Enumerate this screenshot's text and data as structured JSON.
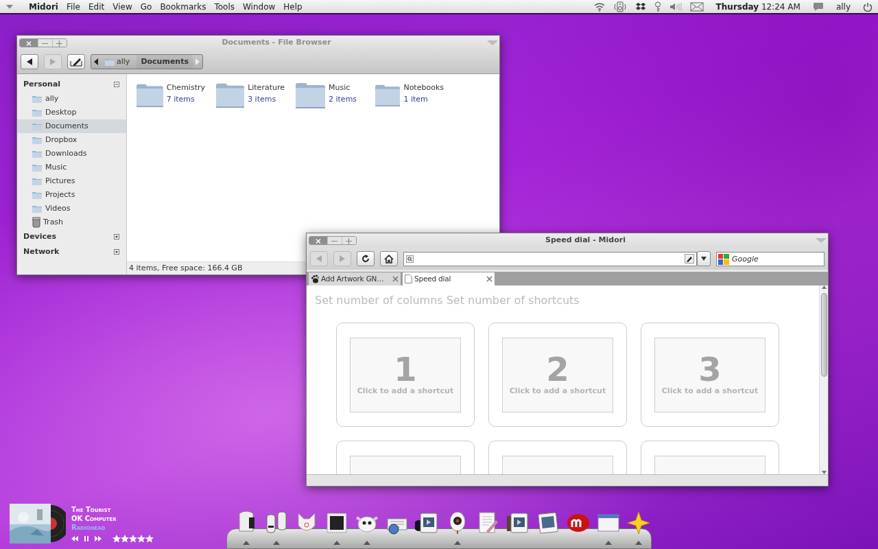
{
  "menubar": {
    "app": "Midori",
    "menus": [
      "File",
      "Edit",
      "View",
      "Go",
      "Bookmarks",
      "Tools",
      "Window",
      "Help"
    ],
    "clock": "**Thursday** 12:24 AM",
    "user": "ally"
  },
  "file_browser": {
    "title": "Documents - File Browser",
    "active": false,
    "path": [
      {
        "label": "ally",
        "selected": false
      },
      {
        "label": "Documents",
        "selected": true
      }
    ],
    "sidebar": [
      {
        "label": "Personal",
        "expanded": true,
        "items": [
          {
            "label": "ally",
            "kind": "home",
            "selected": false
          },
          {
            "label": "Desktop",
            "kind": "folder",
            "selected": false
          },
          {
            "label": "Documents",
            "kind": "folder",
            "selected": true
          },
          {
            "label": "Dropbox",
            "kind": "folder",
            "selected": false
          },
          {
            "label": "Downloads",
            "kind": "folder",
            "selected": false
          },
          {
            "label": "Music",
            "kind": "folder",
            "selected": false
          },
          {
            "label": "Pictures",
            "kind": "folder",
            "selected": false
          },
          {
            "label": "Projects",
            "kind": "folder",
            "selected": false
          },
          {
            "label": "Videos",
            "kind": "folder",
            "selected": false
          },
          {
            "label": "Trash",
            "kind": "trash",
            "selected": false
          }
        ]
      },
      {
        "label": "Devices",
        "expanded": false
      },
      {
        "label": "Network",
        "expanded": false
      }
    ],
    "folders": [
      {
        "name": "Chemistry",
        "count": "7 items"
      },
      {
        "name": "Literature",
        "count": "3 items"
      },
      {
        "name": "Music",
        "count": "2 items"
      },
      {
        "name": "Notebooks",
        "count": "1 item"
      }
    ],
    "status": "4 items, Free space: 166.4 GB"
  },
  "browser": {
    "title": "Speed dial - Midori",
    "active": true,
    "search": {
      "placeholder": "Google"
    },
    "tabs": [
      {
        "label": "Add Artwork GN…",
        "selected": false
      },
      {
        "label": "Speed dial",
        "selected": true
      }
    ],
    "links": [
      "Set number of columns",
      "Set number of shortcuts"
    ],
    "tiles": [
      {
        "kind": "full",
        "number": "1",
        "caption": "Click to add a shortcut"
      },
      {
        "kind": "full",
        "number": "2",
        "caption": "Click to add a shortcut"
      },
      {
        "kind": "full",
        "number": "3",
        "caption": "Click to add a shortcut"
      },
      {
        "kind": "partial"
      },
      {
        "kind": "partial"
      },
      {
        "kind": "partial"
      }
    ]
  },
  "player": {
    "title": "The Tourist",
    "album": "OK Computer",
    "artist": "Radiohead",
    "stars": 5
  },
  "dock": [
    {
      "running": true
    },
    {
      "running": true
    },
    {
      "running": false
    },
    {
      "running": true
    },
    {
      "running": true
    },
    {
      "running": false
    },
    {
      "running": false
    },
    {
      "running": true
    },
    {
      "running": false
    },
    {
      "running": false
    },
    {
      "running": false
    },
    {
      "running": false
    },
    {
      "running": true
    },
    {
      "running": true
    }
  ]
}
